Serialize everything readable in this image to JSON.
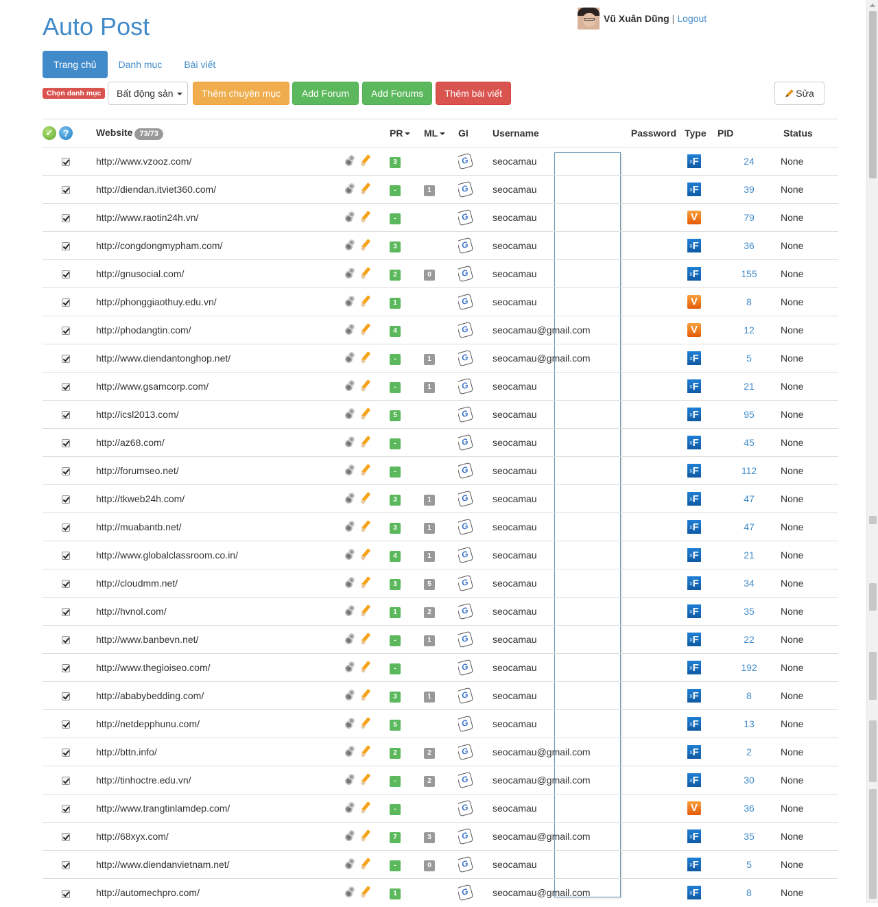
{
  "header": {
    "brand": "Auto Post",
    "user_name": "Vũ Xuân Dũng",
    "separator": "|",
    "logout_label": "Logout"
  },
  "nav": {
    "tabs": [
      {
        "label": "Trang chủ",
        "active": true
      },
      {
        "label": "Danh mục",
        "active": false
      },
      {
        "label": "Bài viết",
        "active": false
      }
    ]
  },
  "toolbar": {
    "category_label": "Chọn danh mục",
    "category_select": "Bất động sản",
    "add_category": "Thêm chuyên mục",
    "add_forum": "Add Forum",
    "add_forums": "Add Forums",
    "add_post": "Thêm bài viết",
    "edit": "Sửa"
  },
  "table": {
    "headers": {
      "website": "Website",
      "count": "73/73",
      "pr": "PR",
      "ml": "ML",
      "gi": "GI",
      "username": "Username",
      "password": "Password",
      "type": "Type",
      "pid": "PID",
      "status": "Status"
    },
    "rows": [
      {
        "website": "http://www.vzooz.com/",
        "pr": "3",
        "ml": "",
        "username": "seocamau",
        "type": "xF",
        "pid": "24",
        "status": "None"
      },
      {
        "website": "http://diendan.itviet360.com/",
        "pr": "-",
        "ml": "1",
        "username": "seocamau",
        "type": "xF",
        "pid": "39",
        "status": "None"
      },
      {
        "website": "http://www.raotin24h.vn/",
        "pr": "-",
        "ml": "",
        "username": "seocamau",
        "type": "V",
        "pid": "79",
        "status": "None"
      },
      {
        "website": "http://congdongmypham.com/",
        "pr": "3",
        "ml": "",
        "username": "seocamau",
        "type": "xF",
        "pid": "36",
        "status": "None"
      },
      {
        "website": "http://gnusocial.com/",
        "pr": "2",
        "ml": "0",
        "username": "seocamau",
        "type": "xF",
        "pid": "155",
        "status": "None"
      },
      {
        "website": "http://phonggiaothuy.edu.vn/",
        "pr": "1",
        "ml": "",
        "username": "seocamau",
        "type": "V",
        "pid": "8",
        "status": "None"
      },
      {
        "website": "http://phodangtin.com/",
        "pr": "4",
        "ml": "",
        "username": "seocamau@gmail.com",
        "type": "V",
        "pid": "12",
        "status": "None"
      },
      {
        "website": "http://www.diendantonghop.net/",
        "pr": "-",
        "ml": "1",
        "username": "seocamau@gmail.com",
        "type": "xF",
        "pid": "5",
        "status": "None"
      },
      {
        "website": "http://www.gsamcorp.com/",
        "pr": "-",
        "ml": "1",
        "username": "seocamau",
        "type": "xF",
        "pid": "21",
        "status": "None"
      },
      {
        "website": "http://icsl2013.com/",
        "pr": "5",
        "ml": "",
        "username": "seocamau",
        "type": "xF",
        "pid": "95",
        "status": "None"
      },
      {
        "website": "http://az68.com/",
        "pr": "-",
        "ml": "",
        "username": "seocamau",
        "type": "xF",
        "pid": "45",
        "status": "None"
      },
      {
        "website": "http://forumseo.net/",
        "pr": "-",
        "ml": "",
        "username": "seocamau",
        "type": "xF",
        "pid": "112",
        "status": "None"
      },
      {
        "website": "http://tkweb24h.com/",
        "pr": "3",
        "ml": "1",
        "username": "seocamau",
        "type": "xF",
        "pid": "47",
        "status": "None"
      },
      {
        "website": "http://muabantb.net/",
        "pr": "3",
        "ml": "1",
        "username": "seocamau",
        "type": "xF",
        "pid": "47",
        "status": "None"
      },
      {
        "website": "http://www.globalclassroom.co.in/",
        "pr": "4",
        "ml": "1",
        "username": "seocamau",
        "type": "xF",
        "pid": "21",
        "status": "None"
      },
      {
        "website": "http://cloudmm.net/",
        "pr": "3",
        "ml": "5",
        "username": "seocamau",
        "type": "xF",
        "pid": "34",
        "status": "None"
      },
      {
        "website": "http://hvnol.com/",
        "pr": "1",
        "ml": "2",
        "username": "seocamau",
        "type": "xF",
        "pid": "35",
        "status": "None"
      },
      {
        "website": "http://www.banbevn.net/",
        "pr": "-",
        "ml": "1",
        "username": "seocamau",
        "type": "xF",
        "pid": "22",
        "status": "None"
      },
      {
        "website": "http://www.thegioiseo.com/",
        "pr": "-",
        "ml": "",
        "username": "seocamau",
        "type": "xF",
        "pid": "192",
        "status": "None"
      },
      {
        "website": "http://ababybedding.com/",
        "pr": "3",
        "ml": "1",
        "username": "seocamau",
        "type": "xF",
        "pid": "8",
        "status": "None"
      },
      {
        "website": "http://netdepphunu.com/",
        "pr": "5",
        "ml": "",
        "username": "seocamau",
        "type": "xF",
        "pid": "13",
        "status": "None"
      },
      {
        "website": "http://bttn.info/",
        "pr": "2",
        "ml": "2",
        "username": "seocamau@gmail.com",
        "type": "xF",
        "pid": "2",
        "status": "None"
      },
      {
        "website": "http://tinhoctre.edu.vn/",
        "pr": "-",
        "ml": "2",
        "username": "seocamau@gmail.com",
        "type": "xF",
        "pid": "30",
        "status": "None"
      },
      {
        "website": "http://www.trangtinlamdep.com/",
        "pr": "-",
        "ml": "",
        "username": "seocamau",
        "type": "V",
        "pid": "36",
        "status": "None"
      },
      {
        "website": "http://68xyx.com/",
        "pr": "7",
        "ml": "3",
        "username": "seocamau@gmail.com",
        "type": "xF",
        "pid": "35",
        "status": "None"
      },
      {
        "website": "http://www.diendanvietnam.net/",
        "pr": "-",
        "ml": "0",
        "username": "seocamau",
        "type": "xF",
        "pid": "5",
        "status": "None"
      },
      {
        "website": "http://automechpro.com/",
        "pr": "1",
        "ml": "",
        "username": "seocamau@gmail.com",
        "type": "xF",
        "pid": "8",
        "status": "None"
      }
    ]
  },
  "colors": {
    "primary": "#428bca",
    "success": "#5cb85c",
    "warning": "#f0ad4e",
    "danger": "#d9534f",
    "badge_gray": "#999999"
  }
}
